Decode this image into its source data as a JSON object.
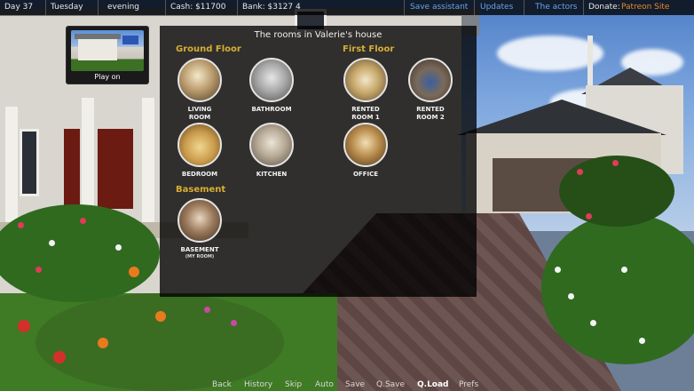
{
  "status_bar": {
    "day": "Day 37",
    "weekday": "Tuesday",
    "time_of_day": "evening",
    "cash": "Cash: $11700",
    "bank": "Bank: $3127 4",
    "save_assistant": "Save assistant",
    "updates": "Updates",
    "the_actors": "The actors",
    "donate_label": "Donate:",
    "donate_link": "Patreon Site"
  },
  "play_on": {
    "label": "Play on"
  },
  "rooms_panel": {
    "title": "The rooms in Valerie's house",
    "sections": {
      "ground": "Ground Floor",
      "first": "First Floor",
      "basement": "Basement"
    },
    "rooms": {
      "living_room": "LIVING\nROOM",
      "bathroom": "BATHROOM",
      "rented_room_1": "RENTED\nROOM 1",
      "rented_room_2": "RENTED\nROOM 2",
      "bedroom": "BEDROOM",
      "kitchen": "KITCHEN",
      "office": "OFFICE",
      "basement": "BASEMENT",
      "basement_sub": "(MY ROOM)"
    }
  },
  "quick_menu": {
    "back": "Back",
    "history": "History",
    "skip": "Skip",
    "auto": "Auto",
    "save": "Save",
    "qsave": "Q.Save",
    "qload": "Q.Load",
    "prefs": "Prefs"
  },
  "colors": {
    "section_heading": "#d8ae35",
    "link_blue": "#6aa3e8",
    "link_orange": "#e8892c"
  }
}
